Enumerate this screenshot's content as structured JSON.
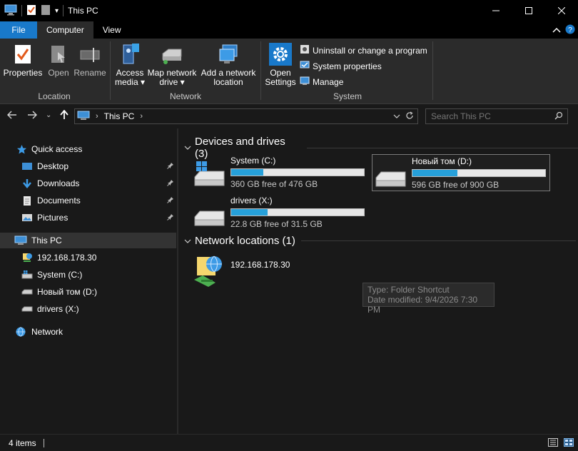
{
  "window": {
    "title": "This PC"
  },
  "tabs": {
    "file": "File",
    "computer": "Computer",
    "view": "View"
  },
  "ribbon": {
    "location": {
      "label": "Location",
      "properties": "Properties",
      "open": "Open",
      "rename": "Rename"
    },
    "network": {
      "label": "Network",
      "access_media_1": "Access",
      "access_media_2": "media",
      "map_drive_1": "Map network",
      "map_drive_2": "drive",
      "add_location_1": "Add a network",
      "add_location_2": "location"
    },
    "system": {
      "label": "System",
      "open_settings_1": "Open",
      "open_settings_2": "Settings",
      "uninstall": "Uninstall or change a program",
      "system_properties": "System properties",
      "manage": "Manage"
    }
  },
  "address": {
    "crumb": "This PC"
  },
  "search": {
    "placeholder": "Search This PC"
  },
  "sidebar": {
    "quick_access": "Quick access",
    "desktop": "Desktop",
    "downloads": "Downloads",
    "documents": "Documents",
    "pictures": "Pictures",
    "this_pc": "This PC",
    "net_share": "192.168.178.30",
    "system_c": "System (C:)",
    "novy_d": "Новый том (D:)",
    "drivers_x": "drivers (X:)",
    "network": "Network"
  },
  "content": {
    "devices_header": "Devices and drives (3)",
    "network_header": "Network locations (1)",
    "drives": [
      {
        "name": "System (C:)",
        "free": "360 GB free of 476 GB",
        "used_fraction": 0.244
      },
      {
        "name": "Новый том (D:)",
        "free": "596 GB free of 900 GB",
        "used_fraction": 0.338
      },
      {
        "name": "drivers (X:)",
        "free": "22.8 GB free of 31.5 GB",
        "used_fraction": 0.276
      }
    ],
    "network_item": "192.168.178.30"
  },
  "tooltip": {
    "type": "Type: Folder Shortcut",
    "modified": "Date modified: 9/4/2026 7:30 PM"
  },
  "status": {
    "items": "4 items"
  },
  "colors": {
    "accent": "#1979ca",
    "bar_fill": "#26a0da"
  }
}
